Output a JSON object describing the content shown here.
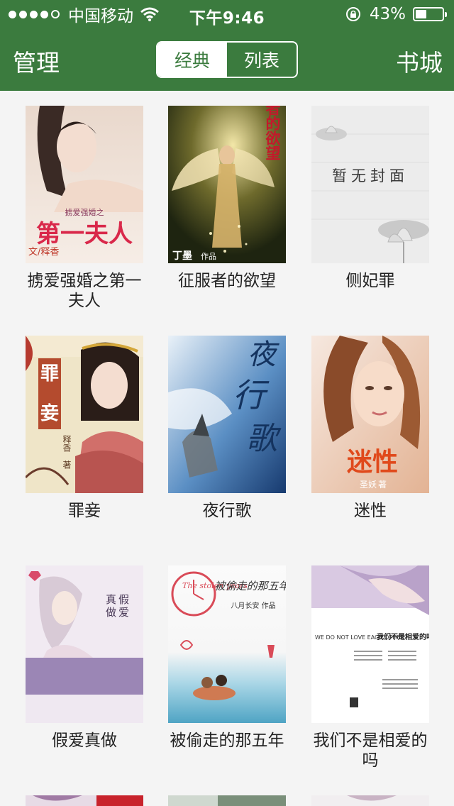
{
  "status_bar": {
    "carrier": "中国移动",
    "time": "下午9:46",
    "battery": "43%",
    "battery_level": 0.43
  },
  "nav": {
    "left_label": "管理",
    "right_label": "书城",
    "segments": [
      "经典",
      "列表"
    ],
    "selected_segment": "经典",
    "accent_color": "#3b7b3e"
  },
  "books": [
    {
      "title": "掳爱强婚之第一夫人",
      "cover_text": [
        "掳爱强婚之",
        "第一夫人",
        "文/释香"
      ]
    },
    {
      "title": "征服者的欲望",
      "cover_text": [
        "征服者的欲望",
        "丁墨",
        "作品"
      ]
    },
    {
      "title": "侧妃罪",
      "cover_text": [
        "暂无封面"
      ]
    },
    {
      "title": "罪妾",
      "cover_text": [
        "罪",
        "妾",
        "释香",
        "著"
      ]
    },
    {
      "title": "夜行歌",
      "cover_text": [
        "夜",
        "行",
        "歌"
      ]
    },
    {
      "title": "迷性",
      "cover_text": [
        "迷性",
        "圣妖",
        "著"
      ]
    },
    {
      "title": "假爱真做",
      "cover_text": [
        "真",
        "做",
        "假",
        "爱"
      ]
    },
    {
      "title": "被偷走的那五年",
      "cover_text": [
        "The stolen years",
        "被偷走的那五年",
        "八月长安 作品"
      ]
    },
    {
      "title": "我们不是相爱的吗",
      "cover_text": [
        "WE DO NOT LOVE EACH OTHER？",
        "我们不是相爱的吗"
      ]
    }
  ]
}
